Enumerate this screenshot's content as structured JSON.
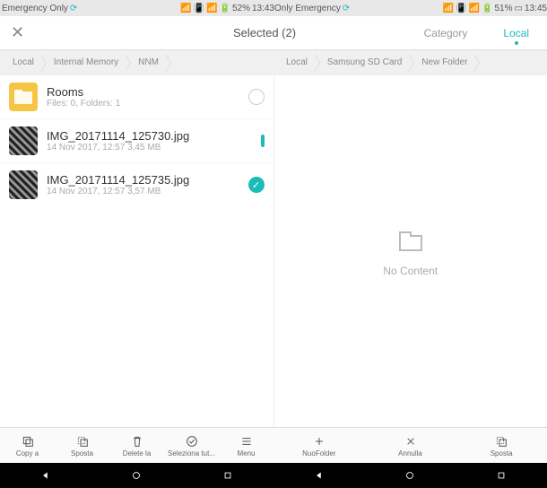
{
  "statusbar": {
    "left_carrier": "Emergency Only",
    "left_battery": "52%",
    "left_time": "13:43",
    "right_carrier": "Only Emergency",
    "right_battery": "51%",
    "right_time": "13:45"
  },
  "header": {
    "title": "Selected (2)",
    "category_label": "Category",
    "local_label": "Local"
  },
  "breadcrumbs_left": [
    "Local",
    "Internal Memory",
    "NNM"
  ],
  "breadcrumbs_right": [
    "Local",
    "Samsung SD Card",
    "New Folder"
  ],
  "files": [
    {
      "name": "Rooms",
      "meta": "Files: 0, Folders: 1",
      "type": "folder",
      "selected": "off"
    },
    {
      "name": "IMG_20171114_125730.jpg",
      "meta": "14 Nov 2017, 12:57 3,45 MB",
      "type": "image",
      "selected": "partial"
    },
    {
      "name": "IMG_20171114_125735.jpg",
      "meta": "14 Nov 2017, 12:57 3,57 MB",
      "type": "image",
      "selected": "on"
    }
  ],
  "empty_label": "No Content",
  "toolbar_left": [
    {
      "label": "Copy a"
    },
    {
      "label": "Sposta"
    },
    {
      "label": "Delete la"
    },
    {
      "label": "Seleziona tut..."
    },
    {
      "label": "Menu"
    }
  ],
  "toolbar_right": [
    {
      "label": "NuoFolder"
    },
    {
      "label": "Annulla"
    },
    {
      "label": "Sposta"
    }
  ]
}
